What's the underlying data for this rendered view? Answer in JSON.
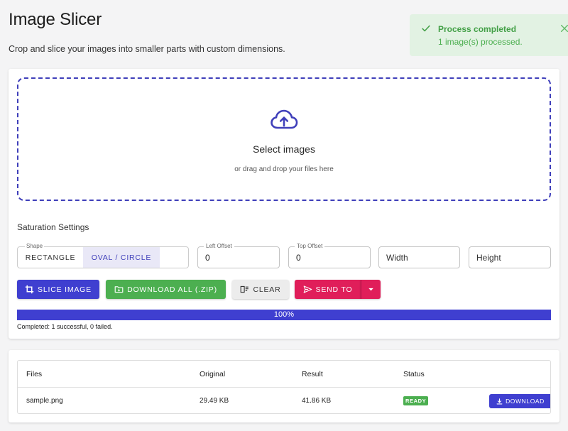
{
  "header": {
    "title": "Image Slicer",
    "subtitle": "Crop and slice your images into smaller parts with custom dimensions."
  },
  "toast": {
    "title": "Process completed",
    "message": "1 image(s) processed."
  },
  "dropzone": {
    "title": "Select images",
    "subtitle": "or drag and drop your files here"
  },
  "settings": {
    "label": "Saturation Settings",
    "shape": {
      "legend": "Shape",
      "options": [
        "RECTANGLE",
        "OVAL / CIRCLE"
      ],
      "selected": "OVAL / CIRCLE"
    },
    "left_offset": {
      "legend": "Left Offset",
      "value": "0"
    },
    "top_offset": {
      "legend": "Top Offset",
      "value": "0"
    },
    "width": {
      "placeholder": "Width",
      "value": ""
    },
    "height": {
      "placeholder": "Height",
      "value": ""
    }
  },
  "actions": {
    "slice": "SLICE IMAGE",
    "download_all": "DOWNLOAD ALL (.ZIP)",
    "clear": "CLEAR",
    "send_to": "SEND TO"
  },
  "progress": {
    "percent": 100,
    "label": "100%",
    "status": "Completed: 1 successful, 0 failed."
  },
  "table": {
    "headers": [
      "Files",
      "Original",
      "Result",
      "Status"
    ],
    "rows": [
      {
        "file": "sample.png",
        "original": "29.49 KB",
        "result": "41.86 KB",
        "status": "READY",
        "action": "DOWNLOAD"
      }
    ]
  },
  "colors": {
    "primary": "#3f3fd0",
    "success": "#4caf50",
    "send": "#e01e5a",
    "toast_bg": "#e2f2e3"
  },
  "icons": {
    "toast": "check-icon",
    "toast_close": "close-icon",
    "dropzone": "cloud-upload-icon",
    "slice": "crop-icon",
    "download_all": "folder-icon",
    "clear": "clear-format-icon",
    "send_to": "send-icon",
    "send_dropdown": "caret-down-icon",
    "row_download": "download-icon"
  }
}
